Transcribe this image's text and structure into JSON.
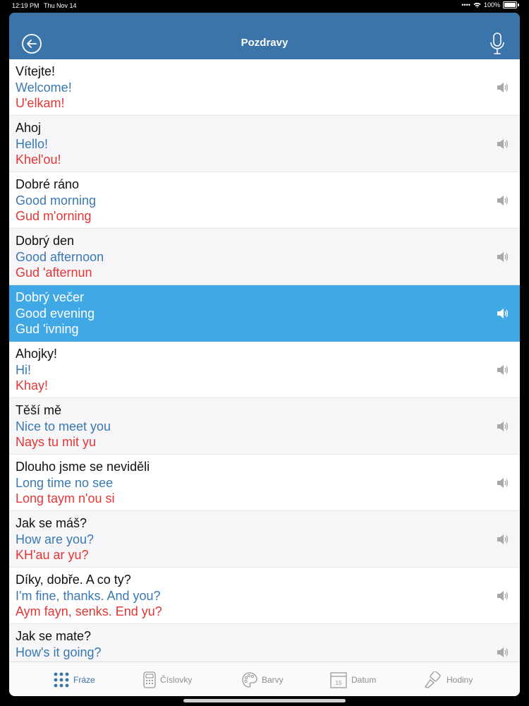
{
  "status": {
    "time": "12:19 PM",
    "date": "Thu Nov 14",
    "battery": "100%"
  },
  "header": {
    "title": "Pozdravy"
  },
  "phrases": [
    {
      "cz": "Vítejte!",
      "en": "Welcome!",
      "pron": "U'elkam!"
    },
    {
      "cz": "Ahoj",
      "en": "Hello!",
      "pron": "Khel'ou!"
    },
    {
      "cz": "Dobré ráno",
      "en": "Good morning",
      "pron": "Gud m'orning"
    },
    {
      "cz": "Dobrý den",
      "en": "Good afternoon",
      "pron": "Gud 'afternun"
    },
    {
      "cz": "Dobrý večer",
      "en": "Good evening",
      "pron": "Gud 'ivning"
    },
    {
      "cz": "Ahojky!",
      "en": "Hi!",
      "pron": "Khay!"
    },
    {
      "cz": "Těší mě",
      "en": "Nice to meet you",
      "pron": "Nays tu mit yu"
    },
    {
      "cz": "Dlouho jsme se neviděli",
      "en": "Long time no see",
      "pron": "Long taym n'ou si"
    },
    {
      "cz": "Jak se máš?",
      "en": "How are you?",
      "pron": "KH'au ar yu?"
    },
    {
      "cz": "Díky, dobře. A co ty?",
      "en": "I'm fine, thanks. And you?",
      "pron": "Aym fayn, senks. End yu?"
    },
    {
      "cz": "Jak se mate?",
      "en": "How's it going?",
      "pron": ""
    }
  ],
  "selected_index": 4,
  "tabs": [
    {
      "label": "Fráze",
      "icon": "grid-icon"
    },
    {
      "label": "Číslovky",
      "icon": "calculator-icon"
    },
    {
      "label": "Barvy",
      "icon": "palette-icon"
    },
    {
      "label": "Datum",
      "icon": "calendar-icon",
      "calendar_day": "15"
    },
    {
      "label": "Hodiny",
      "icon": "clock-icon"
    }
  ],
  "colors": {
    "navbar": "#3a74a8",
    "selected_row": "#40a8e4",
    "english": "#3a78b0",
    "pronunciation": "#e53535"
  }
}
